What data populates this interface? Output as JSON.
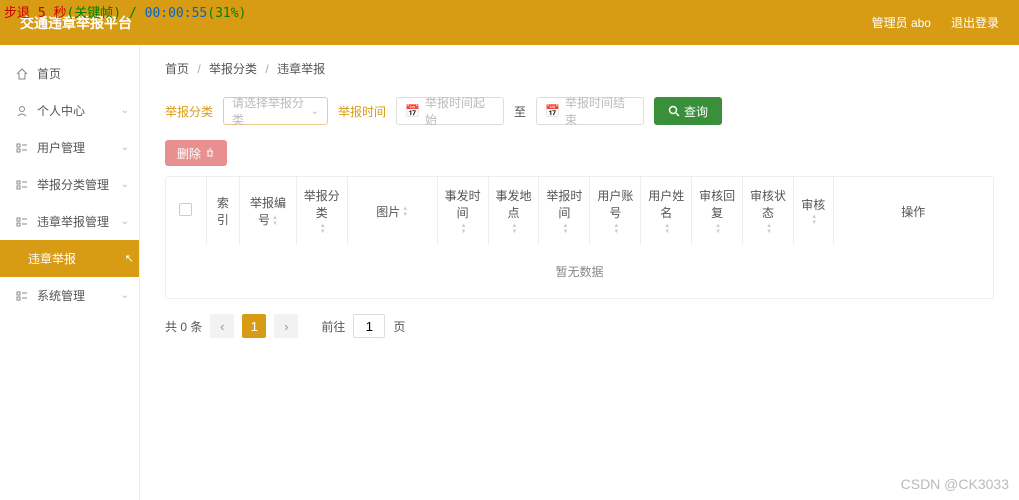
{
  "overlay": {
    "line": "步退 5 秒(关键帧) / 00:00:55(31%)"
  },
  "header": {
    "title": "交通违章举报平台",
    "admin": "管理员 abo",
    "logout": "退出登录"
  },
  "sidebar": {
    "items": [
      {
        "label": "首页",
        "icon": "home"
      },
      {
        "label": "个人中心",
        "icon": "user"
      },
      {
        "label": "用户管理",
        "icon": "list"
      },
      {
        "label": "举报分类管理",
        "icon": "list"
      },
      {
        "label": "违章举报管理",
        "icon": "list"
      },
      {
        "label": "违章举报",
        "icon": "",
        "sub": true,
        "active": true
      },
      {
        "label": "系统管理",
        "icon": "list"
      }
    ]
  },
  "breadcrumb": {
    "a": "首页",
    "b": "举报分类",
    "c": "违章举报"
  },
  "filter": {
    "category_label": "举报分类",
    "category_placeholder": "请选择举报分类",
    "time_label": "举报时间",
    "start_placeholder": "举报时间起始",
    "to": "至",
    "end_placeholder": "举报时间结束",
    "query": "查询"
  },
  "buttons": {
    "delete": "删除"
  },
  "table": {
    "cols": [
      "索引",
      "举报编号",
      "举报分类",
      "图片",
      "事发时间",
      "事发地点",
      "举报时间",
      "用户账号",
      "用户姓名",
      "审核回复",
      "审核状态",
      "审核",
      "操作"
    ],
    "empty": "暂无数据"
  },
  "pagination": {
    "total": "共 0 条",
    "current": "1",
    "goto": "前往",
    "page_suffix": "页",
    "goto_value": "1"
  },
  "watermark": "CSDN @CK3033"
}
